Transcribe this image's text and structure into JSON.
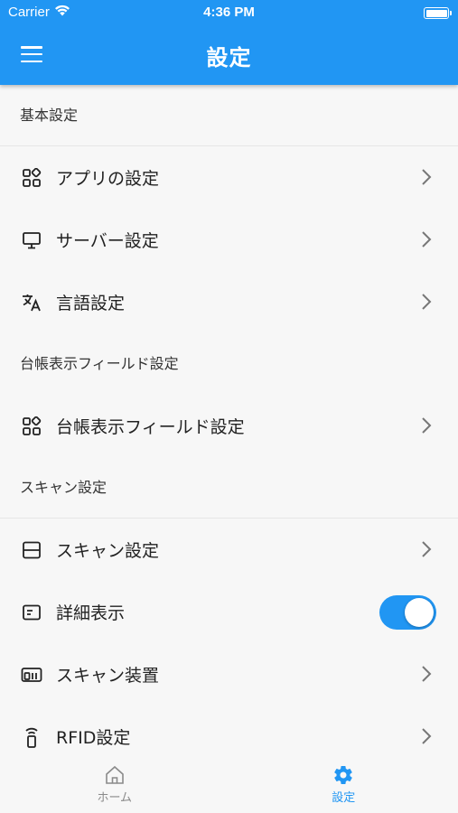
{
  "status_bar": {
    "carrier": "Carrier",
    "time": "4:36 PM"
  },
  "header": {
    "title": "設定"
  },
  "sections": {
    "basic": {
      "title": "基本設定",
      "items": [
        {
          "label": "アプリの設定",
          "icon": "apps-grid-icon"
        },
        {
          "label": "サーバー設定",
          "icon": "monitor-icon"
        },
        {
          "label": "言語設定",
          "icon": "translate-icon"
        }
      ]
    },
    "ledger": {
      "title": "台帳表示フィールド設定",
      "items": [
        {
          "label": "台帳表示フィールド設定",
          "icon": "apps-grid-icon"
        }
      ]
    },
    "scan": {
      "title": "スキャン設定",
      "items": [
        {
          "label": "スキャン設定",
          "icon": "scan-frame-icon"
        },
        {
          "label": "詳細表示",
          "icon": "detail-card-icon",
          "toggle": true
        },
        {
          "label": "スキャン装置",
          "icon": "devices-icon"
        },
        {
          "label": "RFID設定",
          "icon": "rfid-icon"
        }
      ]
    }
  },
  "bottom_nav": {
    "home_label": "ホーム",
    "settings_label": "設定"
  },
  "colors": {
    "primary": "#2196f3",
    "background": "#f7f7f7",
    "inactive": "#8a8a8a"
  }
}
